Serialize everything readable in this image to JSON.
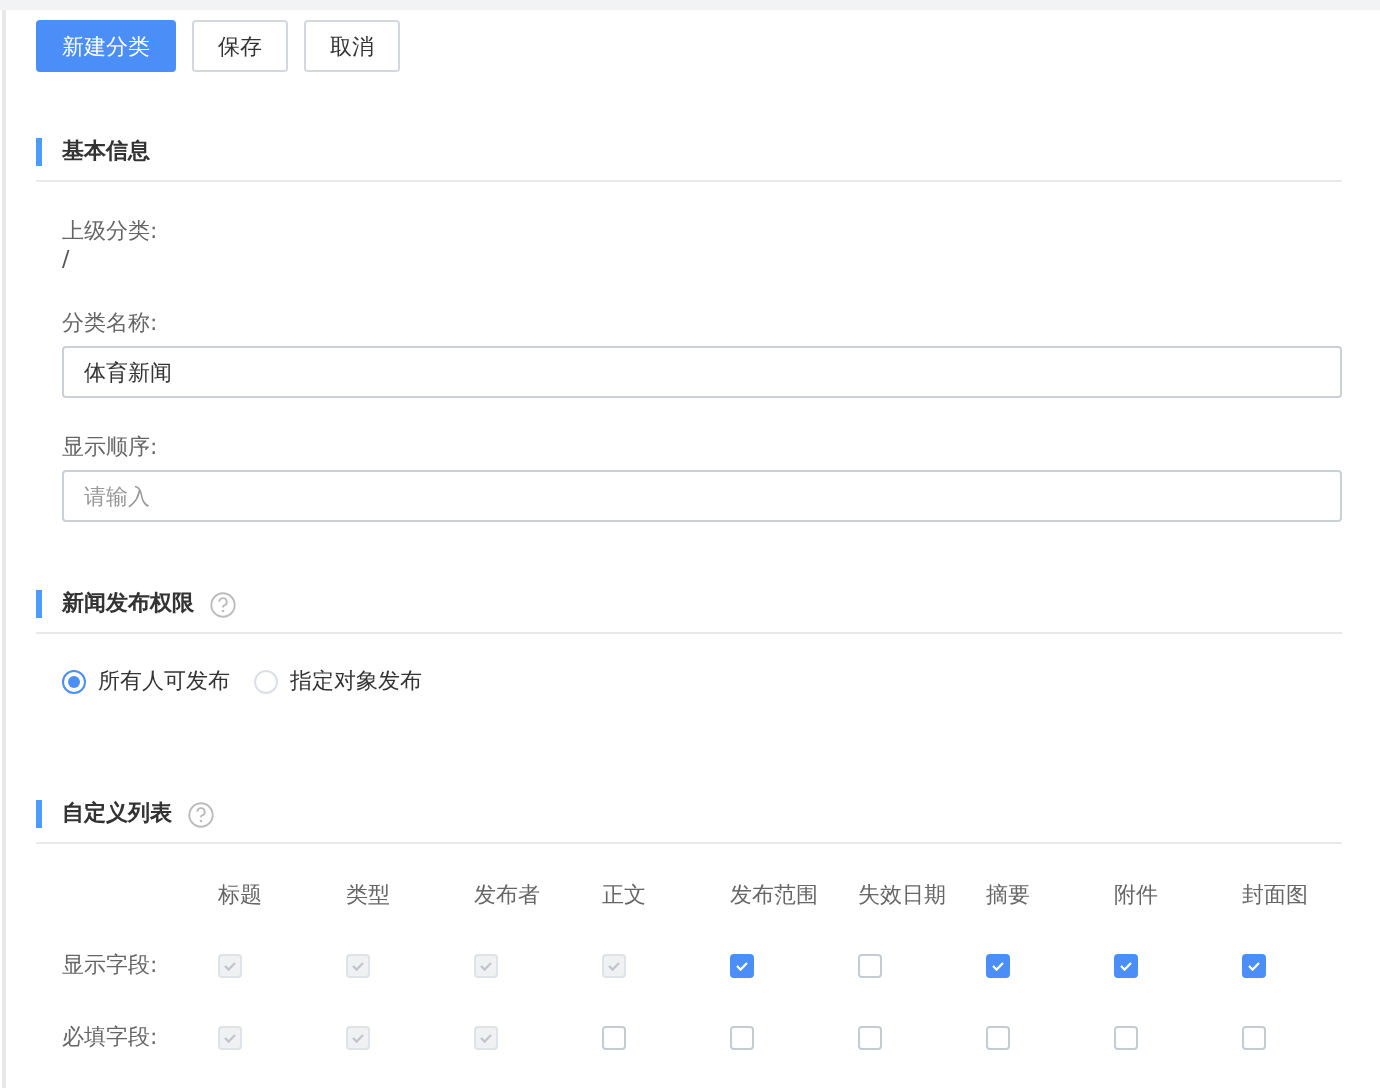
{
  "buttons": [
    {
      "label": "新建分类",
      "kind": "primary"
    },
    {
      "label": "保存",
      "kind": "default"
    },
    {
      "label": "取消",
      "kind": "default"
    }
  ],
  "basic": {
    "title": "基本信息",
    "parent_label": "上级分类:",
    "parent_value": "/",
    "name_label": "分类名称:",
    "name_value": "体育新闻",
    "order_label": "显示顺序:",
    "order_placeholder": "请输入"
  },
  "permission": {
    "title": "新闻发布权限",
    "options": [
      {
        "label": "所有人可发布",
        "selected": true
      },
      {
        "label": "指定对象发布",
        "selected": false
      }
    ]
  },
  "custom_list": {
    "title": "自定义列表",
    "columns": [
      "标题",
      "类型",
      "发布者",
      "正文",
      "发布范围",
      "失效日期",
      "摘要",
      "附件",
      "封面图"
    ],
    "rows": [
      {
        "label": "显示字段:",
        "cells": [
          {
            "checked": true,
            "disabled": true
          },
          {
            "checked": true,
            "disabled": true
          },
          {
            "checked": true,
            "disabled": true
          },
          {
            "checked": true,
            "disabled": true
          },
          {
            "checked": true,
            "disabled": false
          },
          {
            "checked": false,
            "disabled": false
          },
          {
            "checked": true,
            "disabled": false
          },
          {
            "checked": true,
            "disabled": false
          },
          {
            "checked": true,
            "disabled": false
          }
        ]
      },
      {
        "label": "必填字段:",
        "cells": [
          {
            "checked": true,
            "disabled": true
          },
          {
            "checked": true,
            "disabled": true
          },
          {
            "checked": true,
            "disabled": true
          },
          {
            "checked": false,
            "disabled": false
          },
          {
            "checked": false,
            "disabled": false
          },
          {
            "checked": false,
            "disabled": false
          },
          {
            "checked": false,
            "disabled": false
          },
          {
            "checked": false,
            "disabled": false
          },
          {
            "checked": false,
            "disabled": false
          }
        ]
      }
    ]
  }
}
